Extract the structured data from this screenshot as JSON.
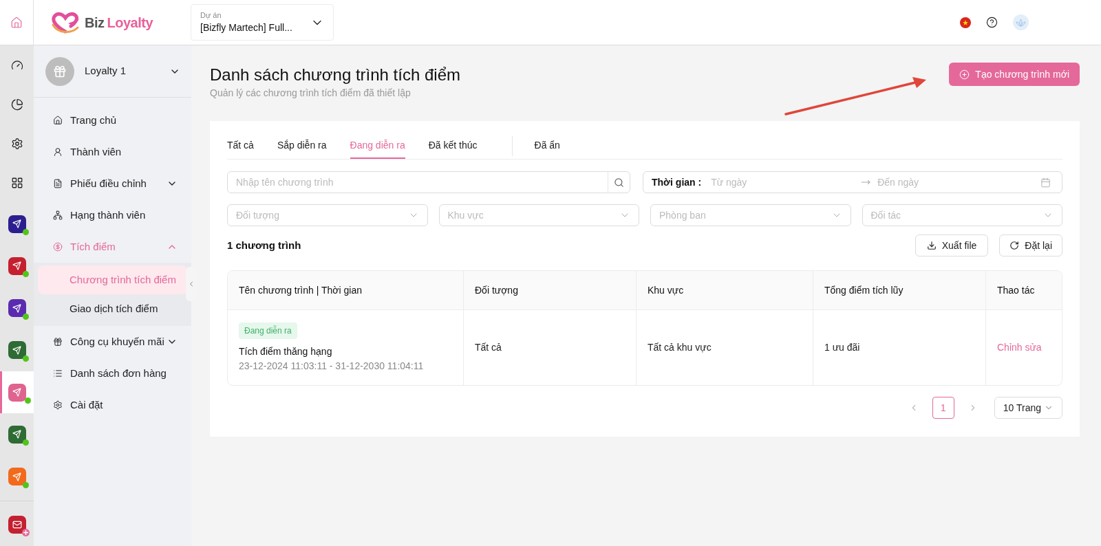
{
  "topbar": {
    "logo": {
      "first": "Biz",
      "second": "Loyalty"
    },
    "project": {
      "label": "Dự án",
      "value": "[Bizfly Martech] Full..."
    }
  },
  "rail": {
    "apps": [
      {
        "color": "#2b1f8f",
        "selected": false,
        "kind": "online"
      },
      {
        "color": "#c4202f",
        "selected": false,
        "kind": "online"
      },
      {
        "color": "#5a2bb0",
        "selected": false,
        "kind": "online"
      },
      {
        "color": "#2f6b35",
        "selected": false,
        "kind": "online"
      },
      {
        "color": "#e0628f",
        "selected": true,
        "kind": "online"
      },
      {
        "color": "#2f6b35",
        "selected": false,
        "kind": "online"
      },
      {
        "color": "#f26a1b",
        "selected": false,
        "kind": "online"
      }
    ],
    "extra": [
      {
        "color": "#c4202f",
        "selected": false,
        "kind": "add"
      }
    ]
  },
  "sidebar": {
    "account": "Loyalty 1",
    "items": [
      {
        "label": "Trang chủ",
        "selected": false
      },
      {
        "label": "Thành viên",
        "selected": false
      },
      {
        "label": "Phiếu điều chỉnh",
        "selected": false,
        "expanded": false
      },
      {
        "label": "Hạng thành viên",
        "selected": false
      },
      {
        "label": "Tích điểm",
        "selected": true,
        "expanded": true,
        "children": [
          {
            "label": "Chương trình tích điểm",
            "selected": true
          },
          {
            "label": "Giao dịch tích điểm",
            "selected": false
          }
        ]
      },
      {
        "label": "Công cụ khuyến mãi",
        "selected": false,
        "expanded": false
      },
      {
        "label": "Danh sách đơn hàng",
        "selected": false
      },
      {
        "label": "Cài đặt",
        "selected": false
      }
    ]
  },
  "page": {
    "title": "Danh sách chương trình tích điểm",
    "subtitle": "Quản lý các chương trình tích điểm đã thiết lập",
    "create_button": "Tạo chương trình mới"
  },
  "tabs": [
    {
      "label": "Tất cả",
      "selected": false
    },
    {
      "label": "Sắp diễn ra",
      "selected": false
    },
    {
      "label": "Đang diễn ra",
      "selected": true
    },
    {
      "label": "Đã kết thúc",
      "selected": false
    },
    {
      "label": "Đã ẩn",
      "selected": false
    }
  ],
  "search": {
    "placeholder": "Nhập tên chương trình"
  },
  "date_range": {
    "label": "Thời gian :",
    "from": "Từ ngày",
    "to": "Đến ngày"
  },
  "filters": [
    {
      "placeholder": "Đối tượng"
    },
    {
      "placeholder": "Khu vực"
    },
    {
      "placeholder": "Phòng ban"
    },
    {
      "placeholder": "Đối tác"
    }
  ],
  "count": "1 chương trình",
  "actions": {
    "export": "Xuất file",
    "reset": "Đặt lại"
  },
  "table": {
    "columns": [
      "Tên chương trình | Thời gian",
      "Đối tượng",
      "Khu vực",
      "Tổng điểm tích lũy",
      "Thao tác"
    ],
    "rows": [
      {
        "status": {
          "label": "Đang diễn ra",
          "kind": "running"
        },
        "name": "Tích điểm thăng hạng",
        "period": "23-12-2024 11:03:11 - 31-12-2030 11:04:11",
        "audience": "Tất cả",
        "region": "Tất cả khu vực",
        "points": "1 ưu đãi",
        "action": "Chỉnh sửa"
      }
    ]
  },
  "pagination": {
    "pages": [
      {
        "label": "1",
        "selected": true
      }
    ],
    "page_size": "10 Trang"
  }
}
